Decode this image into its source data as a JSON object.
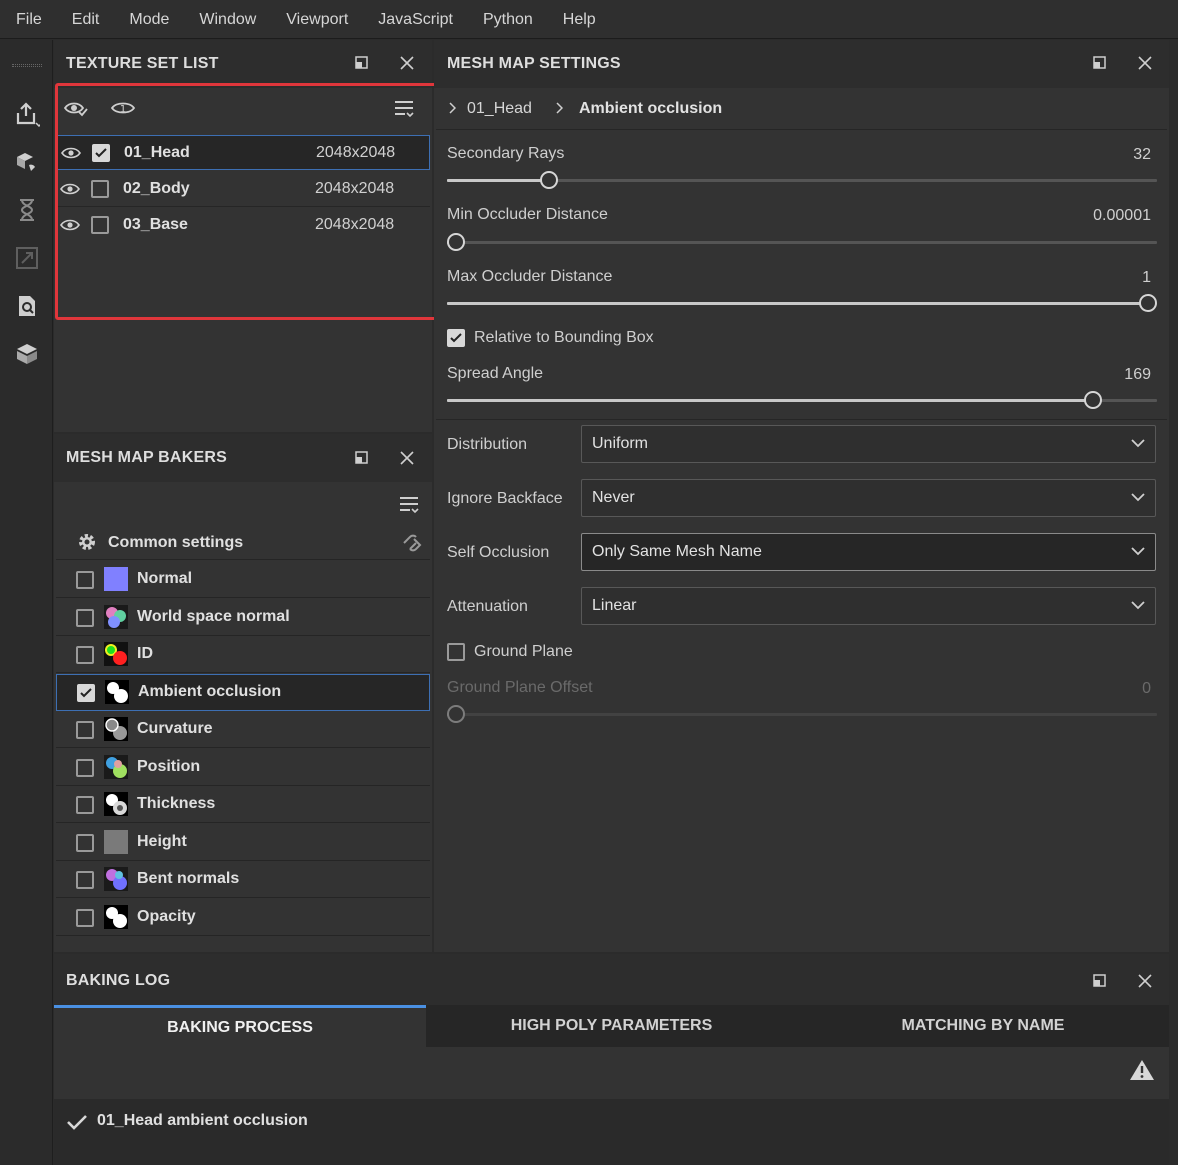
{
  "menu": [
    "File",
    "Edit",
    "Mode",
    "Window",
    "Viewport",
    "JavaScript",
    "Python",
    "Help"
  ],
  "toolbar_icons": [
    "export-icon",
    "bake-icon",
    "hourglass-icon",
    "resize-icon",
    "search-file-icon",
    "box-icon"
  ],
  "texture_set_list": {
    "title": "TEXTURE SET LIST",
    "items": [
      {
        "name": "01_Head",
        "size": "2048x2048",
        "checked": true,
        "selected": true
      },
      {
        "name": "02_Body",
        "size": "2048x2048",
        "checked": false,
        "selected": false
      },
      {
        "name": "03_Base",
        "size": "2048x2048",
        "checked": false,
        "selected": false
      }
    ]
  },
  "mesh_map_bakers": {
    "title": "MESH MAP BAKERS",
    "common_settings": "Common settings",
    "items": [
      {
        "label": "Normal",
        "checked": false,
        "swatch": "normal"
      },
      {
        "label": "World space normal",
        "checked": false,
        "swatch": "world"
      },
      {
        "label": "ID",
        "checked": false,
        "swatch": "id"
      },
      {
        "label": "Ambient occlusion",
        "checked": true,
        "swatch": "ao",
        "selected": true
      },
      {
        "label": "Curvature",
        "checked": false,
        "swatch": "curvature"
      },
      {
        "label": "Position",
        "checked": false,
        "swatch": "position"
      },
      {
        "label": "Thickness",
        "checked": false,
        "swatch": "thickness"
      },
      {
        "label": "Height",
        "checked": false,
        "swatch": "height"
      },
      {
        "label": "Bent normals",
        "checked": false,
        "swatch": "bent"
      },
      {
        "label": "Opacity",
        "checked": false,
        "swatch": "opacity"
      }
    ]
  },
  "mesh_map_settings": {
    "title": "MESH MAP SETTINGS",
    "breadcrumb": [
      "01_Head",
      "Ambient occlusion"
    ],
    "secondary_rays": {
      "label": "Secondary Rays",
      "value": "32",
      "level": 0.135
    },
    "min_occluder": {
      "label": "Min Occluder Distance",
      "value": "0.00001",
      "level": 0.0
    },
    "max_occluder": {
      "label": "Max Occluder Distance",
      "value": "1",
      "level": 1.0
    },
    "relative_bbox": {
      "label": "Relative to Bounding Box",
      "checked": true
    },
    "spread_angle": {
      "label": "Spread Angle",
      "value": "169",
      "level": 0.92
    },
    "distribution": {
      "label": "Distribution",
      "value": "Uniform"
    },
    "ignore_backface": {
      "label": "Ignore Backface",
      "value": "Never"
    },
    "self_occlusion": {
      "label": "Self Occlusion",
      "value": "Only Same Mesh Name"
    },
    "attenuation": {
      "label": "Attenuation",
      "value": "Linear"
    },
    "ground_plane": {
      "label": "Ground Plane",
      "checked": false
    },
    "ground_plane_offset": {
      "label": "Ground Plane Offset",
      "value": "0",
      "level": 0.0
    }
  },
  "baking_log": {
    "title": "BAKING LOG",
    "tabs": [
      "BAKING PROCESS",
      "HIGH POLY PARAMETERS",
      "MATCHING BY NAME"
    ],
    "active_tab": 0,
    "entries": [
      "01_Head ambient occlusion"
    ]
  },
  "colors": {
    "highlight_red": "#e0363b",
    "selection_blue": "#3d6fb3",
    "accent_tab": "#4a90e2"
  }
}
